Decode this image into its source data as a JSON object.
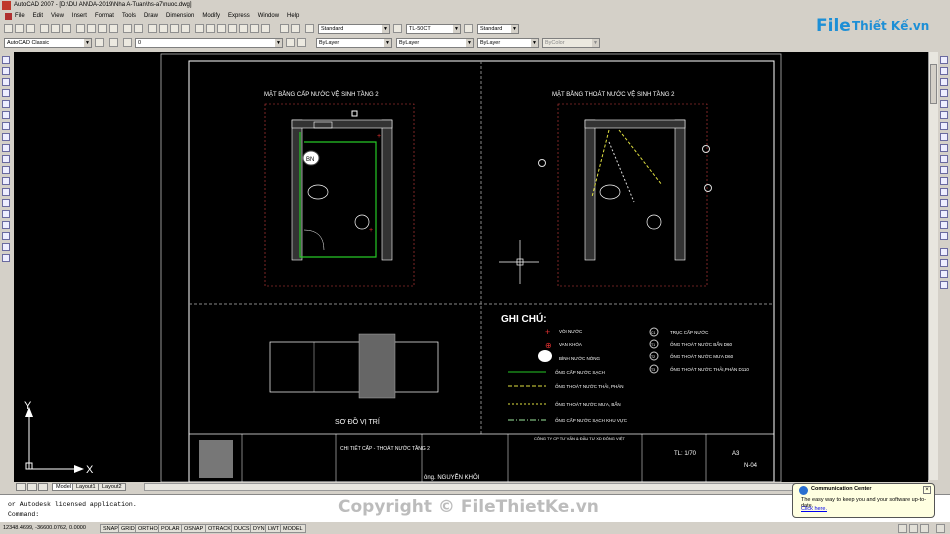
{
  "window": {
    "title": "AutoCAD 2007 - [D:\\DU AN\\DA-2019\\Nha A-Tuan\\hs-a7\\nuoc.dwg]"
  },
  "menu": [
    "File",
    "Edit",
    "View",
    "Insert",
    "Format",
    "Tools",
    "Draw",
    "Dimension",
    "Modify",
    "Express",
    "Window",
    "Help"
  ],
  "toolbar": {
    "workspace": "AutoCAD Classic",
    "text_style": "Standard",
    "dim_style": "TL-50CT",
    "table_style": "Standard",
    "layer": "0",
    "color": "ByLayer",
    "linetype": "ByLayer",
    "lineweight": "ByLayer",
    "plotstyle": "ByColor"
  },
  "logo": {
    "part1": "File",
    "part2": "Thiết Kế.vn"
  },
  "drawing": {
    "plan1_title": "MẶT BẰNG  CẤP NƯỚC VỆ SINH TẦNG 2",
    "plan2_title": "MẶT BẰNG THOÁT NƯỚC VỆ SINH TẦNG 2",
    "bn": "BN",
    "location_title": "SƠ ĐỒ VỊ TRÍ",
    "legend_title": "GHI CHÚ:",
    "legend_left": [
      "VÒI NƯỚC",
      "VAN KHÓA",
      "BÌNH NƯỚC NÓNG",
      "ỐNG CẤP NƯỚC SẠCH",
      "ỐNG THOÁT NƯỚC THẢI, PHÂN",
      "ỐNG THOÁT NƯỚC MƯA, BẨN",
      "ỐNG CẤP NƯỚC SẠCH KHU VỰC"
    ],
    "legend_right_codes": [
      "C1",
      "T1",
      "T2",
      "T3"
    ],
    "legend_right": [
      "TRỤC CẤP NƯỚC",
      "ỐNG THOÁT NƯỚC BẨN D60",
      "ỐNG THOÁT NƯỚC MƯA D60",
      "ỐNG THOÁT NƯỚC THẢI,PHÂN D110"
    ],
    "titleblock": {
      "sheet_name": "CHI TIẾT CẤP - THOÁT NƯỚC TẦNG 2",
      "owner": "ông. NGUYỄN KHÔI",
      "company": "CÔNG TY CP TƯ VẤN & ĐẦU TƯ XD ĐÔNG VIỆT",
      "scale": "TL: 1/70",
      "paper": "A3",
      "sheet_no": "N-04"
    }
  },
  "ucs": {
    "x": "X",
    "y": "Y"
  },
  "tabs": [
    "Model",
    "Layout1",
    "Layout2"
  ],
  "command": {
    "line1": "or Autodesk licensed application.",
    "line2": "Command:"
  },
  "status": {
    "coords": "12348.4699, -36600.0762, 0.0000",
    "buttons": [
      "SNAP",
      "GRID",
      "ORTHO",
      "POLAR",
      "OSNAP",
      "OTRACK",
      "DUCS",
      "DYN",
      "LWT",
      "MODEL"
    ]
  },
  "balloon": {
    "title": "Communication Center",
    "body": "The easy way to keep you and your software up-to-date.",
    "link": "Click here."
  },
  "watermark": "Copyright © FileThietKe.vn"
}
